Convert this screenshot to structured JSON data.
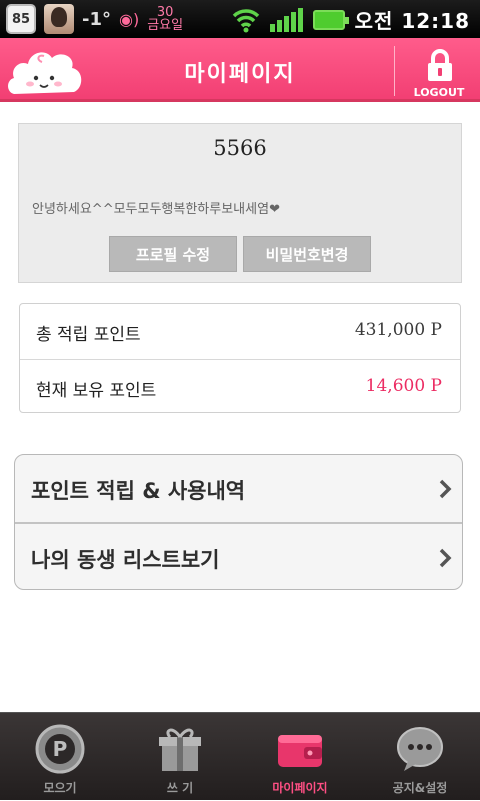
{
  "status_bar": {
    "badge": "85",
    "temperature": "-1°",
    "mini_label_top": "30",
    "mini_label_bottom": "금요일",
    "time": "오전 12:18"
  },
  "header": {
    "title": "마이페이지",
    "logout_label": "LOGOUT"
  },
  "profile": {
    "name": "5566",
    "message": "안녕하세요^^모두모두행복한하루보내세염❤",
    "edit_button": "프로필 수정",
    "password_button": "비밀번호변경"
  },
  "points": {
    "total_label": "총 적립 포인트",
    "total_value": "431,000 P",
    "current_label": "현재 보유 포인트",
    "current_value": "14,600 P"
  },
  "menu": {
    "items": [
      {
        "label": "포인트 적립 & 사용내역"
      },
      {
        "label": "나의 동생 리스트보기"
      }
    ]
  },
  "tabbar": {
    "tabs": [
      {
        "label": "모으기",
        "icon": "p-coin-icon"
      },
      {
        "label": "쓰 기",
        "icon": "gift-icon"
      },
      {
        "label": "마이페이지",
        "icon": "wallet-icon"
      },
      {
        "label": "공지&설정",
        "icon": "chat-bubble-icon"
      }
    ],
    "active_index": 2
  },
  "colors": {
    "brand_pink": "#f23f73",
    "point_highlight": "#ec2c63",
    "active_tab": "#ff4f84"
  }
}
